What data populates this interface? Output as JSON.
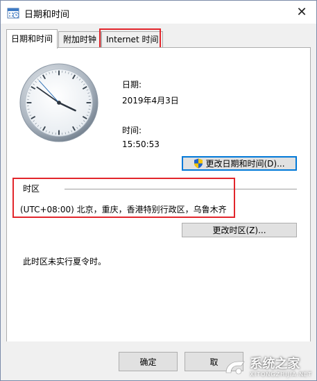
{
  "window": {
    "title": "日期和时间",
    "close_glyph": "✕"
  },
  "tabs": [
    {
      "label": "日期和时间",
      "active": true
    },
    {
      "label": "附加时钟",
      "active": false
    },
    {
      "label": "Internet 时间",
      "active": false,
      "highlighted": true
    }
  ],
  "clock": {
    "hour": 15,
    "minute": 50,
    "second": 53
  },
  "date": {
    "label": "日期:",
    "value": "2019年4月3日"
  },
  "time": {
    "label": "时间:",
    "value": "15:50:53"
  },
  "change_datetime_button": {
    "label": "更改日期和时间(D)...",
    "icon": "uac-shield-icon"
  },
  "timezone": {
    "header": "时区",
    "value": "(UTC+08:00) 北京，重庆，香港特别行政区，乌鲁木齐",
    "change_button": "更改时区(Z)...",
    "dst_note": "此时区未实行夏令时。"
  },
  "footer": {
    "ok_label": "确定",
    "cancel_label": "取"
  },
  "watermark": {
    "cn": "系统之家",
    "en": "XITONGZHIJIA.NET"
  },
  "colors": {
    "highlight": "#e2252b",
    "focus": "#0078d7",
    "window_bg": "#f0f0f0"
  }
}
